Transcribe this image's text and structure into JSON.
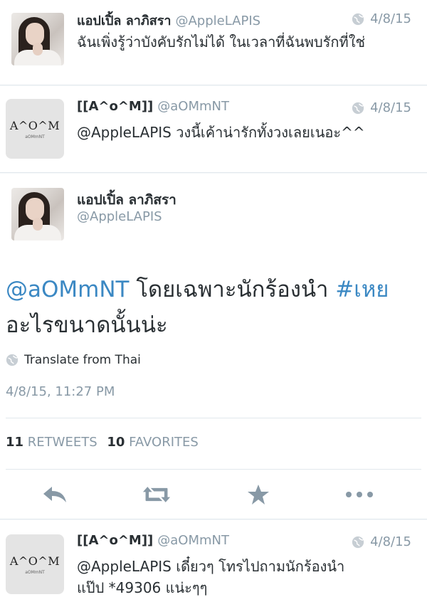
{
  "tweets_above": [
    {
      "name": "แอปเปิ้ล ลาภิสรา",
      "handle": "@AppleLAPIS",
      "date": "4/8/15",
      "text": "ฉันเพิ่งรู้ว่าบังคับรักไม่ได้ ในเวลาที่ฉันพบรักที่ใช่"
    },
    {
      "name": "[[A^o^M]]",
      "handle": "@aOMmNT",
      "date": "4/8/15",
      "text": "@AppleLAPIS วงนี้เค้าน่ารักทั้งวงเลยเนอะ^^",
      "avatar_text": "A^O^M",
      "avatar_subtext": "aOMmNT"
    }
  ],
  "main_tweet": {
    "name": "แอปเปิ้ล ลาภิสรา",
    "handle": "@AppleLAPIS",
    "mention": "@aOMmNT",
    "text_middle": " โดยเฉพาะนักร้องนำ ",
    "hashtag": "#เหย",
    "text_line2": "อะไรขนาดนั้นน่ะ",
    "translate_label": "Translate from Thai",
    "timestamp": "4/8/15, 11:27 PM",
    "retweets_count": "11",
    "retweets_label": "RETWEETS",
    "favorites_count": "10",
    "favorites_label": "FAVORITES"
  },
  "reply_below": {
    "name": "[[A^o^M]]",
    "handle": "@aOMmNT",
    "date": "4/8/15",
    "text_line1": "@AppleLAPIS เดี๋ยวๆ โทรไปถามนักร้องนำ",
    "text_line2": "แป๊ป *49306 แน่ะๆๆ",
    "avatar_text": "A^O^M",
    "avatar_subtext": "aOMmNT"
  },
  "icons": {
    "reply": "reply-icon",
    "retweet": "retweet-icon",
    "favorite": "star-icon",
    "more": "more-icon",
    "globe": "globe-icon"
  },
  "colors": {
    "link": "#3b88c3",
    "muted": "#8899a6",
    "text": "#292f33",
    "icon": "#8899a6"
  }
}
